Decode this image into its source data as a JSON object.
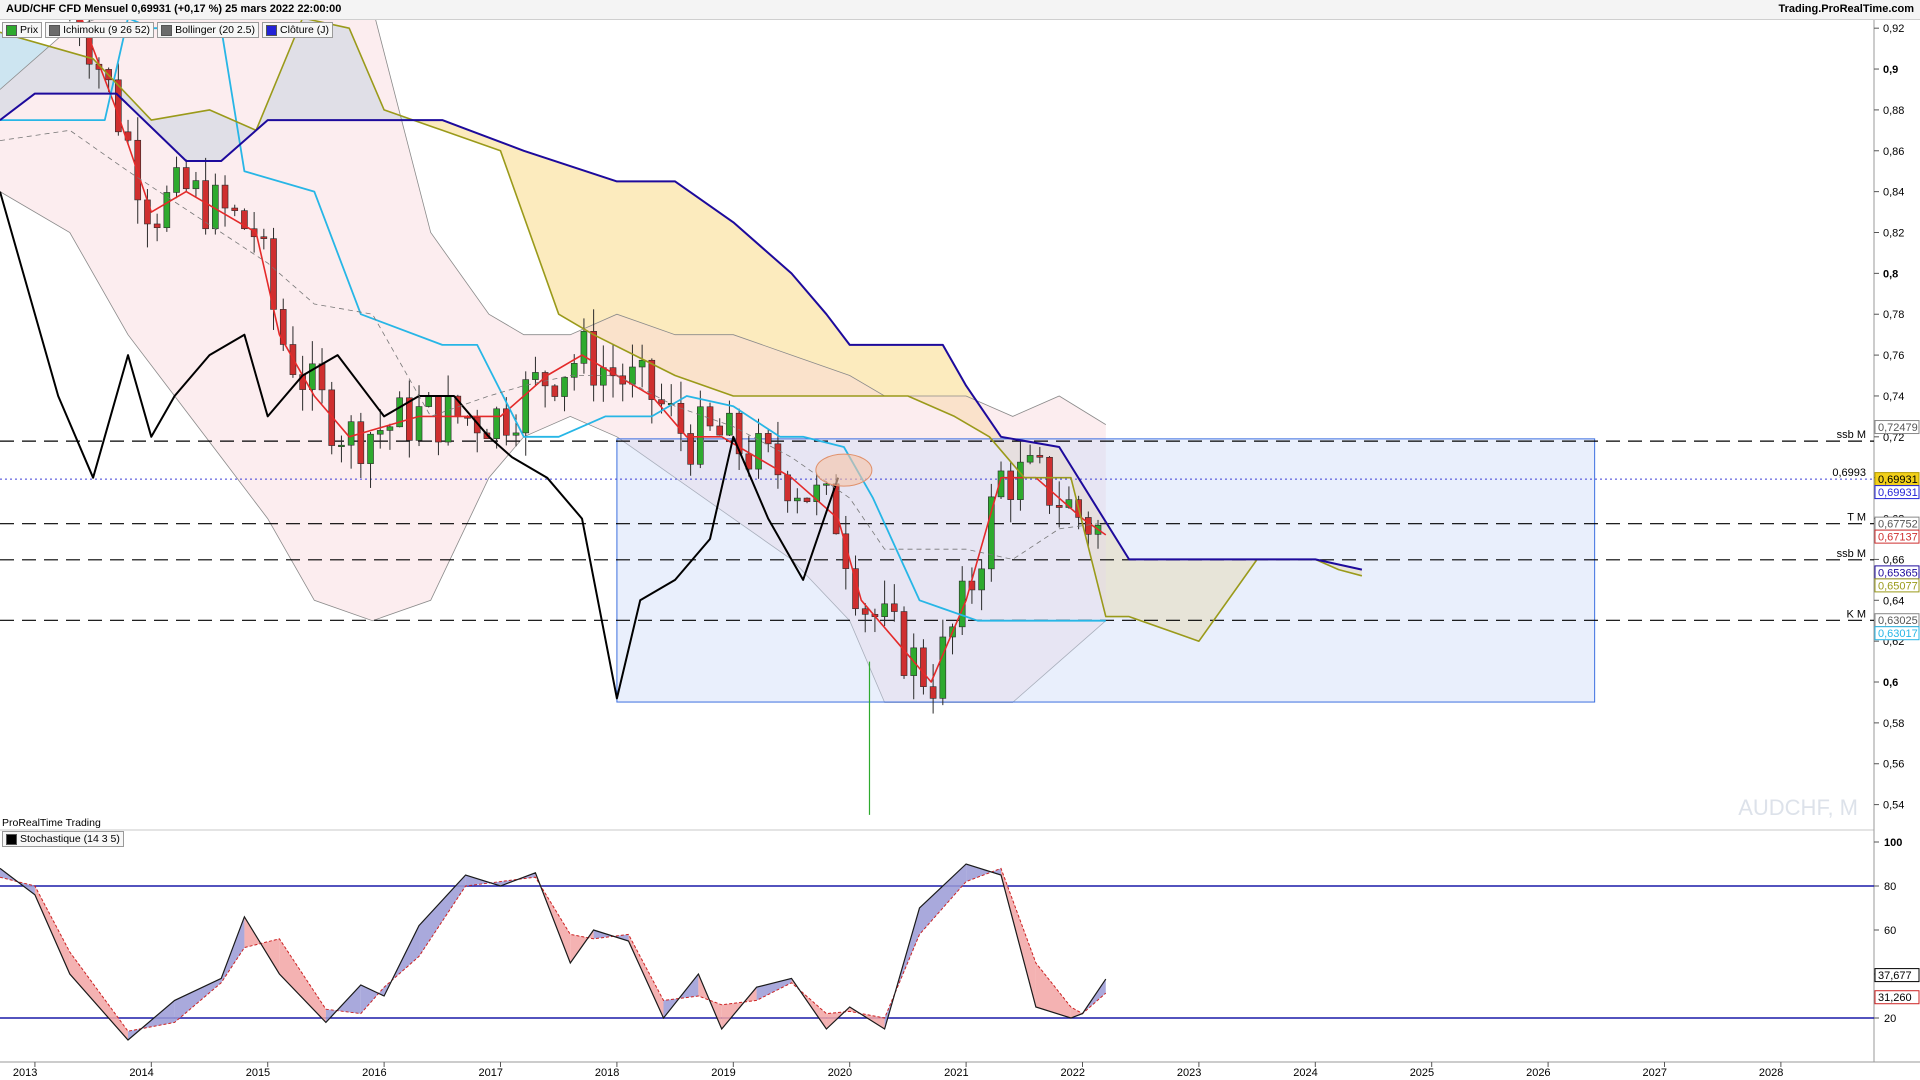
{
  "header": {
    "title": "AUD/CHF CFD Mensuel 0,69931 (+0,17 %) 25 mars 2022 22:00:00",
    "brand": "Trading.ProRealTime.com"
  },
  "legend": [
    {
      "label": "Prix",
      "color": "#2eaa2e"
    },
    {
      "label": "Ichimoku (9 26 52)",
      "color": "#6b6b6b"
    },
    {
      "label": "Bollinger (20 2.5)",
      "color": "#6b6b6b"
    },
    {
      "label": "Clôture (J)",
      "color": "#2323d6"
    }
  ],
  "sub_panel": {
    "title": "ProRealTime Trading",
    "indicator": "Stochastique (14 3 5)"
  },
  "watermark": "AUDCHF, M",
  "colors": {
    "bull": "#2eaa2e",
    "bear": "#cf2f2f",
    "tenkan": "#e42a2a",
    "kijun": "#27b6e6",
    "ssa": "#9a9a1a",
    "ssb": "#1d0a9c",
    "chikou": "#000000",
    "selection": "#3d6fe0",
    "stoch_k": "#1a1a1a",
    "stoch_d": "#cc2222",
    "band": "#1a1aa8"
  },
  "chart_data": [
    {
      "type": "candlestick",
      "title": "AUD/CHF CFD Mensuel",
      "x_axis": {
        "labels": [
          "2013",
          "2014",
          "2015",
          "2016",
          "2017",
          "2018",
          "2019",
          "2020",
          "2021",
          "2022",
          "2023",
          "2024",
          "2025",
          "2026",
          "2027",
          "2028"
        ],
        "range": [
          2012.7,
          2028.8
        ]
      },
      "y_axis": {
        "ticks": [
          "0,92",
          "0,9",
          "0,88",
          "0,86",
          "0,84",
          "0,82",
          "0,8",
          "0,78",
          "0,76",
          "0,74",
          "0,72",
          "0,7",
          "0,68",
          "0,66",
          "0,64",
          "0,62",
          "0,6",
          "0,58",
          "0,56",
          "0,54"
        ],
        "bold_ticks": [
          "0,9",
          "0,8",
          "0,6"
        ],
        "range": [
          0.531,
          0.924
        ]
      },
      "price_boxes": [
        {
          "label": "0,72479",
          "value": 0.72479,
          "bg": "#ffffff",
          "fg": "#555555",
          "border": "#888888"
        },
        {
          "label": "0,69931",
          "value": 0.69931,
          "bg": "#f2d01a",
          "fg": "#000000",
          "border": "#b59b00"
        },
        {
          "label": "0,69931",
          "value": 0.69931,
          "bg": "#ffffff",
          "fg": "#2323d6",
          "border": "#2323d6"
        },
        {
          "label": "0,67752",
          "value": 0.67752,
          "bg": "#ffffff",
          "fg": "#555555",
          "border": "#888888"
        },
        {
          "label": "0,67137",
          "value": 0.67137,
          "bg": "#ffffff",
          "fg": "#cf2f2f",
          "border": "#cf2f2f"
        },
        {
          "label": "0,65365",
          "value": 0.65365,
          "bg": "#ffffff",
          "fg": "#1d0a9c",
          "border": "#1d0a9c"
        },
        {
          "label": "0,65077",
          "value": 0.65077,
          "bg": "#ffffff",
          "fg": "#9a9a1a",
          "border": "#9a9a1a"
        },
        {
          "label": "0,63025",
          "value": 0.63025,
          "bg": "#ffffff",
          "fg": "#555555",
          "border": "#888888"
        },
        {
          "label": "0,63017",
          "value": 0.63017,
          "bg": "#ffffff",
          "fg": "#27b6e6",
          "border": "#27b6e6"
        }
      ],
      "levels": [
        {
          "label": "ssb M",
          "value": 0.7179,
          "style": "dashed"
        },
        {
          "label": "0,6993",
          "value": 0.6993,
          "style": "dotted"
        },
        {
          "label": "T M",
          "value": 0.6775,
          "style": "dashed"
        },
        {
          "label": "ssb M",
          "value": 0.6598,
          "style": "dashed"
        },
        {
          "label": "K M",
          "value": 0.6302,
          "style": "dashed"
        }
      ],
      "selection_box": {
        "x_from": 2018.0,
        "x_to": 2026.4,
        "y_from": 0.5902,
        "y_to": 0.719
      },
      "highlight_ellipse": {
        "x": 2019.95,
        "y": 0.7037
      },
      "series": [
        {
          "name": "Tenkan",
          "x": [
            2013.4,
            2013.7,
            2014.0,
            2014.3,
            2014.6,
            2014.9,
            2015.1,
            2015.4,
            2015.7,
            2016.0,
            2016.3,
            2016.6,
            2017.0,
            2017.4,
            2017.7,
            2018.0,
            2018.3,
            2018.6,
            2018.9,
            2019.2,
            2019.5,
            2019.9,
            2020.1,
            2020.4,
            2020.7,
            2021.0,
            2021.3,
            2021.6,
            2022.0,
            2022.2
          ],
          "y": [
            0.925,
            0.88,
            0.83,
            0.84,
            0.83,
            0.82,
            0.77,
            0.74,
            0.72,
            0.725,
            0.73,
            0.73,
            0.73,
            0.75,
            0.76,
            0.75,
            0.74,
            0.72,
            0.72,
            0.71,
            0.7,
            0.68,
            0.64,
            0.62,
            0.6,
            0.64,
            0.7,
            0.7,
            0.68,
            0.672
          ]
        },
        {
          "name": "Kijun",
          "x": [
            2012.7,
            2013.6,
            2013.8,
            2014.0,
            2014.6,
            2014.8,
            2015.4,
            2015.8,
            2016.5,
            2016.8,
            2017.2,
            2017.5,
            2017.9,
            2018.3,
            2018.6,
            2019.0,
            2019.4,
            2019.6,
            2019.95,
            2020.2,
            2020.6,
            2020.8,
            2021.1,
            2021.5,
            2022.0,
            2022.2
          ],
          "y": [
            0.875,
            0.875,
            0.925,
            0.92,
            0.92,
            0.85,
            0.84,
            0.78,
            0.765,
            0.765,
            0.72,
            0.72,
            0.73,
            0.73,
            0.74,
            0.735,
            0.72,
            0.72,
            0.715,
            0.69,
            0.64,
            0.636,
            0.63,
            0.63,
            0.63,
            0.63
          ]
        },
        {
          "name": "SSA",
          "x": [
            2012.7,
            2013.5,
            2014.0,
            2014.5,
            2014.9,
            2015.3,
            2015.7,
            2016.0,
            2016.5,
            2017.0,
            2017.5,
            2017.8,
            2018.5,
            2019.0,
            2019.5,
            2020.0,
            2020.5,
            2020.9,
            2021.2,
            2021.5,
            2021.9,
            2022.2,
            2022.4,
            2023.0,
            2023.5,
            2024.0,
            2024.2,
            2024.4
          ],
          "y": [
            0.918,
            0.905,
            0.875,
            0.88,
            0.87,
            0.925,
            0.92,
            0.88,
            0.87,
            0.86,
            0.78,
            0.77,
            0.75,
            0.74,
            0.74,
            0.74,
            0.74,
            0.73,
            0.72,
            0.7,
            0.7,
            0.632,
            0.632,
            0.62,
            0.66,
            0.66,
            0.655,
            0.652
          ]
        },
        {
          "name": "SSB",
          "x": [
            2012.7,
            2013.0,
            2013.7,
            2014.3,
            2014.6,
            2015.0,
            2016.0,
            2016.5,
            2017.2,
            2018.0,
            2018.5,
            2019.0,
            2019.5,
            2019.8,
            2020.0,
            2020.4,
            2020.8,
            2021.0,
            2021.3,
            2021.8,
            2022.4,
            2023.0,
            2024.0,
            2024.4
          ],
          "y": [
            0.875,
            0.888,
            0.888,
            0.855,
            0.855,
            0.875,
            0.875,
            0.875,
            0.86,
            0.845,
            0.845,
            0.825,
            0.8,
            0.78,
            0.765,
            0.765,
            0.765,
            0.745,
            0.72,
            0.715,
            0.66,
            0.66,
            0.66,
            0.655
          ]
        },
        {
          "name": "Chikou",
          "x": [
            2012.7,
            2012.9,
            2013.2,
            2013.5,
            2013.8,
            2014.0,
            2014.2,
            2014.5,
            2014.8,
            2015.0,
            2015.3,
            2015.6,
            2016.0,
            2016.3,
            2016.6,
            2016.9,
            2017.1,
            2017.4,
            2017.7,
            2018.0,
            2018.2,
            2018.5,
            2018.8,
            2019.0,
            2019.3,
            2019.6,
            2019.9
          ],
          "y": [
            0.84,
            0.8,
            0.74,
            0.7,
            0.76,
            0.72,
            0.74,
            0.76,
            0.77,
            0.73,
            0.75,
            0.76,
            0.73,
            0.74,
            0.74,
            0.72,
            0.71,
            0.7,
            0.68,
            0.592,
            0.64,
            0.65,
            0.67,
            0.72,
            0.68,
            0.65,
            0.7
          ]
        }
      ]
    },
    {
      "type": "line",
      "title": "Stochastique (14 3 5)",
      "y_axis": {
        "ticks": [
          "100",
          "80",
          "60",
          "40",
          "20"
        ],
        "bold_ticks": [
          "100"
        ],
        "range": [
          0,
          100
        ]
      },
      "bands": [
        80,
        20
      ],
      "value_boxes": [
        {
          "label": "37,677",
          "value": 37.677,
          "color": "#000000"
        },
        {
          "label": "31,260",
          "value": 31.26,
          "color": "#cc2222"
        }
      ],
      "series": [
        {
          "name": "%K",
          "x": [
            2012.7,
            2013.0,
            2013.3,
            2013.8,
            2014.2,
            2014.6,
            2014.8,
            2015.1,
            2015.5,
            2015.8,
            2016.0,
            2016.3,
            2016.7,
            2017.0,
            2017.3,
            2017.6,
            2017.8,
            2018.1,
            2018.4,
            2018.7,
            2018.9,
            2019.2,
            2019.5,
            2019.8,
            2020.0,
            2020.3,
            2020.6,
            2021.0,
            2021.3,
            2021.6,
            2021.9,
            2022.0,
            2022.2
          ],
          "y": [
            88,
            76,
            40,
            10,
            28,
            38,
            66,
            40,
            18,
            35,
            30,
            62,
            85,
            80,
            86,
            45,
            60,
            55,
            20,
            40,
            15,
            34,
            38,
            15,
            25,
            15,
            70,
            90,
            85,
            25,
            20,
            22,
            37.7
          ]
        },
        {
          "name": "%D",
          "x": [
            2012.7,
            2013.0,
            2013.3,
            2013.8,
            2014.2,
            2014.6,
            2014.8,
            2015.1,
            2015.5,
            2015.8,
            2016.0,
            2016.3,
            2016.7,
            2017.0,
            2017.3,
            2017.6,
            2017.8,
            2018.1,
            2018.4,
            2018.7,
            2018.9,
            2019.2,
            2019.5,
            2019.8,
            2020.0,
            2020.3,
            2020.6,
            2021.0,
            2021.3,
            2021.6,
            2021.9,
            2022.0,
            2022.2
          ],
          "y": [
            84,
            80,
            50,
            14,
            18,
            36,
            52,
            56,
            24,
            22,
            34,
            48,
            80,
            82,
            84,
            58,
            56,
            58,
            28,
            30,
            26,
            28,
            36,
            22,
            23,
            20,
            58,
            82,
            88,
            45,
            25,
            22,
            31.3
          ]
        }
      ]
    }
  ]
}
